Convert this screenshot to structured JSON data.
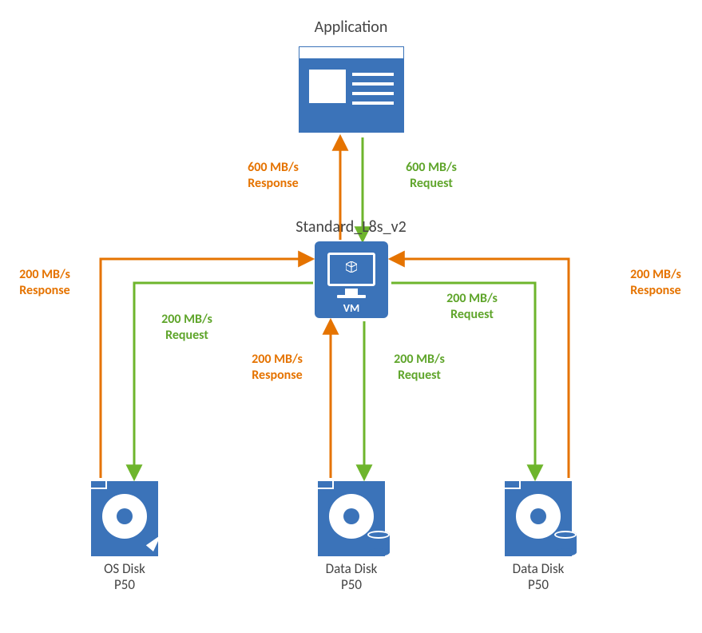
{
  "application": {
    "title": "Application"
  },
  "vm": {
    "title": "Standard_L8s_v2",
    "label": "VM"
  },
  "disks": {
    "os": {
      "name": "OS Disk",
      "tier": "P50"
    },
    "d1": {
      "name": "Data Disk",
      "tier": "P50"
    },
    "d2": {
      "name": "Data Disk",
      "tier": "P50"
    }
  },
  "flows": {
    "app_response": {
      "l1": "600 MB/s",
      "l2": "Response"
    },
    "app_request": {
      "l1": "600 MB/s",
      "l2": "Request"
    },
    "os_response": {
      "l1": "200 MB/s",
      "l2": "Response"
    },
    "os_request": {
      "l1": "200 MB/s",
      "l2": "Request"
    },
    "d1_response": {
      "l1": "200 MB/s",
      "l2": "Response"
    },
    "d1_request": {
      "l1": "200 MB/s",
      "l2": "Request"
    },
    "d2_response": {
      "l1": "200 MB/s",
      "l2": "Response"
    },
    "d2_request": {
      "l1": "200 MB/s",
      "l2": "Request"
    }
  },
  "colors": {
    "blue": "#3b73b9",
    "orange": "#e57300",
    "green": "#6eb52c"
  }
}
